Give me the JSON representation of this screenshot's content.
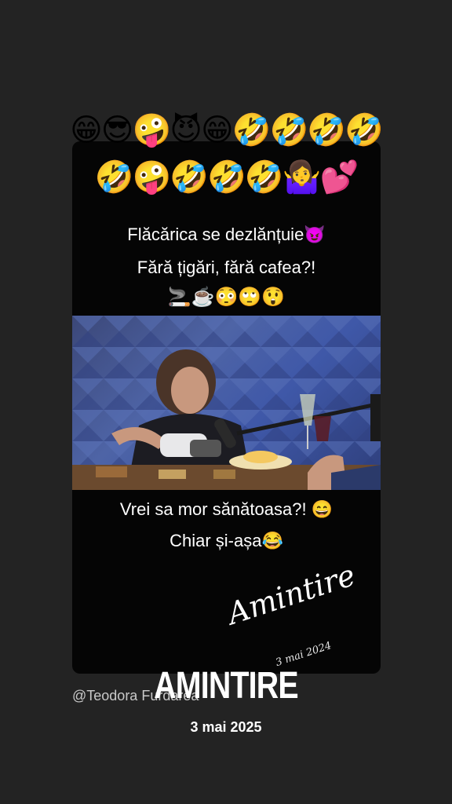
{
  "emoji_line_1": "😁😎🤪😈😁🤣🤣🤣🤣",
  "emoji_line_2": "🤣🤪🤣🤣🤣🤷‍♀️💕",
  "caption_1": "Flăcărica se dezlănțuie😈",
  "caption_2": "Fără țigări, fără cafea?!",
  "caption_3": "🚬☕😳🙄😲",
  "caption_4": "Vrei sa mor sănătoasa?! 😄",
  "caption_5": "Chiar și-așa😂",
  "handwritten_title": "Amintire",
  "handwritten_date": "3 mai 2024",
  "username": "@Teodora Furdarea",
  "memory_title": "AMINTIRE",
  "memory_date": "3 mai 2025",
  "colors": {
    "background": "#232323",
    "card": "#050505",
    "text": "#ffffff"
  }
}
